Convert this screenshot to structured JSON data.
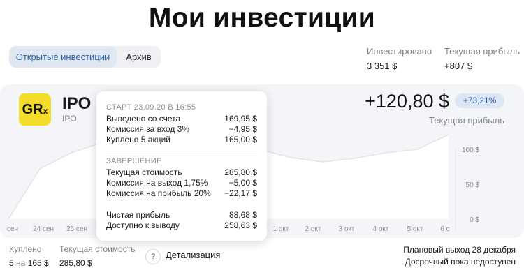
{
  "page": {
    "title": "Мои инвестиции"
  },
  "tabs": [
    {
      "label": "Открытые инвестиции",
      "active": true
    },
    {
      "label": "Архив",
      "active": false
    }
  ],
  "summary": {
    "invested_label": "Инвестировано",
    "invested_value": "3 351 $",
    "profit_label": "Текущая прибыль",
    "profit_value": "+807 $"
  },
  "card": {
    "logo_text": "GR",
    "logo_sub": "x",
    "ticker": "IPO",
    "ticker_sub": "IPO",
    "profit_value": "+120,80 $",
    "profit_pct": "+73,21%",
    "profit_label": "Текущая прибыль",
    "colors": {
      "logo_bg": "#f3dc2a",
      "badge_bg": "#dce6f4",
      "accent": "#2a5ea8"
    }
  },
  "chart_data": {
    "type": "area",
    "x_ticks": [
      "сен",
      "24 сен",
      "25 сен",
      "1 окт",
      "2 окт",
      "3 окт",
      "4 окт",
      "5 окт",
      "6 с"
    ],
    "y_ticks": [
      "100 $",
      "50 $",
      "0 $"
    ],
    "ylim": [
      0,
      125
    ],
    "values": [
      0,
      72,
      95,
      110,
      110,
      105,
      100,
      104,
      100,
      88,
      82,
      87,
      95,
      100,
      121
    ],
    "grid": false
  },
  "tooltip": {
    "start_header": "СТАРТ 23.09.20 В 16:55",
    "start_rows": [
      {
        "label": "Выведено со счета",
        "value": "169,95 $"
      },
      {
        "label": "Комиссия за вход 3%",
        "value": "−4,95 $"
      },
      {
        "label": "Куплено 5 акций",
        "value": "165,00 $"
      }
    ],
    "end_header": "ЗАВЕРШЕНИЕ",
    "end_rows": [
      {
        "label": "Текущая стоимость",
        "value": "285,80 $"
      },
      {
        "label": "Комиссия на выход 1,75%",
        "value": "−5,00 $"
      },
      {
        "label": "Комиссия на прибыль 20%",
        "value": "−22,17 $"
      }
    ],
    "result_rows": [
      {
        "label": "Чистая прибыль",
        "value": "88,68 $"
      },
      {
        "label": "Доступно к выводу",
        "value": "258,63 $"
      }
    ]
  },
  "footer": {
    "bought_label": "Куплено",
    "bought_count": "5",
    "bought_word": "на",
    "bought_amount": "165 $",
    "cost_label": "Текущая стоимость",
    "cost_value": "285,80 $",
    "help_symbol": "?",
    "detail_label": "Детализация",
    "exit_plan": "Плановый выход 28 декабря",
    "early_exit": "Досрочный пока недоступен"
  }
}
